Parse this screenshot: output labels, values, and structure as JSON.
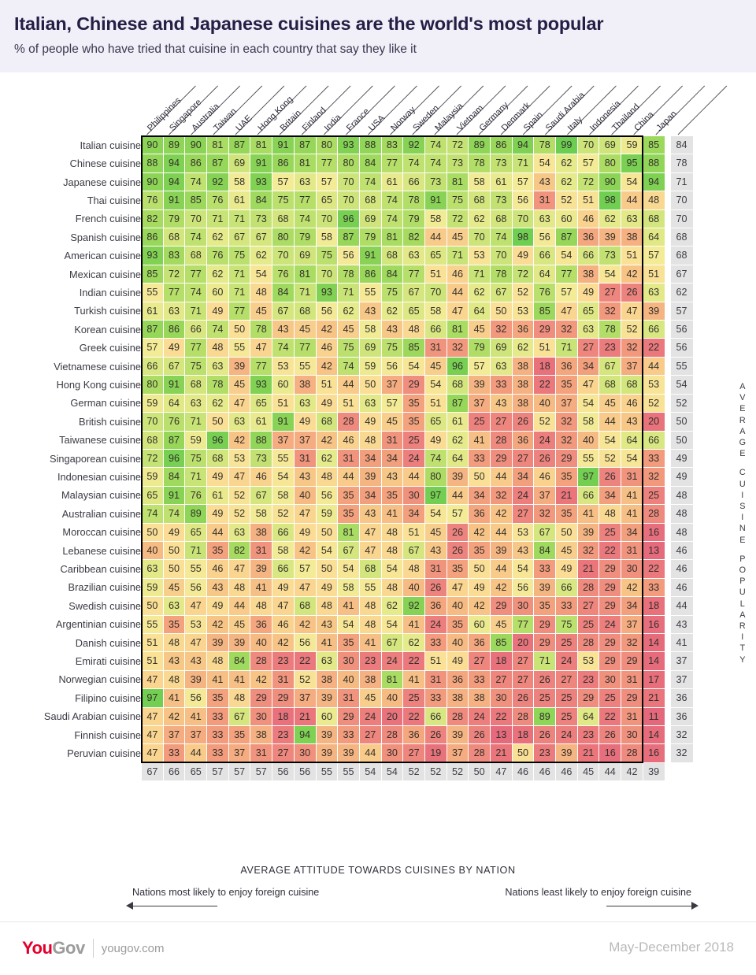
{
  "header": {
    "title": "Italian, Chinese and Japanese cuisines are the world's most popular",
    "subtitle": "% of people who have tried that cuisine in each country that say they like it"
  },
  "captions": {
    "bottom_axis": "AVERAGE ATTITUDE TOWARDS CUISINES BY NATION",
    "vertical_axis": "AVERAGE CUISINE POPULARITY",
    "arrow_left": "Nations most likely to enjoy foreign cuisine",
    "arrow_right": "Nations least likely to enjoy foreign cuisine"
  },
  "footer": {
    "logo_you": "You",
    "logo_gov": "Gov",
    "url": "yougov.com",
    "date": "May-December 2018"
  },
  "chart_data": {
    "type": "heatmap",
    "title": "Italian, Chinese and Japanese cuisines are the world's most popular",
    "subtitle": "% of people who have tried that cuisine in each country that say they like it",
    "xlabel": "AVERAGE ATTITUDE TOWARDS CUISINES BY NATION",
    "ylabel": "AVERAGE CUISINE POPULARITY",
    "value_range": [
      11,
      99
    ],
    "columns": [
      "Philippines",
      "Singapore",
      "Australia",
      "Taiwan",
      "UAE",
      "Hong Kong",
      "Britain",
      "Finland",
      "India",
      "France",
      "USA",
      "Norway",
      "Sweden",
      "Malaysia",
      "Vietnam",
      "Germany",
      "Denmark",
      "Spain",
      "Saudi Arabia",
      "Italy",
      "Indonesia",
      "Thailand",
      "China"
    ],
    "avg_column_label": "Japan",
    "rows": [
      "Italian cuisine",
      "Chinese cuisine",
      "Japanese cuisine",
      "Thai cuisine",
      "French cuisine",
      "Spanish cuisine",
      "American cuisine",
      "Mexican cuisine",
      "Indian cuisine",
      "Turkish cuisine",
      "Korean cuisine",
      "Greek cuisine",
      "Vietnamese cuisine",
      "Hong Kong cuisine",
      "German cuisine",
      "British cuisine",
      "Taiwanese cuisine",
      "Singaporean cuisine",
      "Indonesian cuisine",
      "Malaysian cuisine",
      "Australian cuisine",
      "Moroccan cuisine",
      "Lebanese cuisine",
      "Caribbean cuisine",
      "Brazilian cuisine",
      "Swedish cuisine",
      "Argentinian cuisine",
      "Danish cuisine",
      "Emirati cuisine",
      "Norwegian cuisine",
      "Filipino cuisine",
      "Saudi Arabian cuisine",
      "Finnish cuisine",
      "Peruvian cuisine"
    ],
    "values": [
      [
        90,
        89,
        90,
        81,
        87,
        81,
        91,
        87,
        80,
        93,
        88,
        83,
        92,
        74,
        72,
        89,
        86,
        94,
        78,
        99,
        70,
        69,
        59,
        85
      ],
      [
        88,
        94,
        86,
        87,
        69,
        91,
        86,
        81,
        77,
        80,
        84,
        77,
        74,
        74,
        73,
        78,
        73,
        71,
        54,
        62,
        57,
        80,
        95,
        88
      ],
      [
        90,
        94,
        74,
        92,
        58,
        93,
        57,
        63,
        57,
        70,
        74,
        61,
        66,
        73,
        81,
        58,
        61,
        57,
        43,
        62,
        72,
        90,
        54,
        94
      ],
      [
        76,
        91,
        85,
        76,
        61,
        84,
        75,
        77,
        65,
        70,
        68,
        74,
        78,
        91,
        75,
        68,
        73,
        56,
        31,
        52,
        51,
        98,
        44,
        48
      ],
      [
        82,
        79,
        70,
        71,
        71,
        73,
        68,
        74,
        70,
        96,
        69,
        74,
        79,
        58,
        72,
        62,
        68,
        70,
        63,
        60,
        46,
        62,
        63,
        68
      ],
      [
        86,
        68,
        74,
        62,
        67,
        67,
        80,
        79,
        58,
        87,
        79,
        81,
        82,
        44,
        45,
        70,
        74,
        98,
        56,
        87,
        36,
        39,
        38,
        64
      ],
      [
        93,
        83,
        68,
        76,
        75,
        62,
        70,
        69,
        75,
        56,
        91,
        68,
        63,
        65,
        71,
        53,
        70,
        49,
        66,
        54,
        66,
        73,
        51,
        57
      ],
      [
        85,
        72,
        77,
        62,
        71,
        54,
        76,
        81,
        70,
        78,
        86,
        84,
        77,
        51,
        46,
        71,
        78,
        72,
        64,
        77,
        38,
        54,
        42,
        51
      ],
      [
        55,
        77,
        74,
        60,
        71,
        48,
        84,
        71,
        93,
        71,
        55,
        75,
        67,
        70,
        44,
        62,
        67,
        52,
        76,
        57,
        49,
        27,
        26,
        63
      ],
      [
        61,
        63,
        71,
        49,
        77,
        45,
        67,
        68,
        56,
        62,
        43,
        62,
        65,
        58,
        47,
        64,
        50,
        53,
        85,
        47,
        65,
        32,
        47,
        39
      ],
      [
        87,
        86,
        66,
        74,
        50,
        78,
        43,
        45,
        42,
        45,
        58,
        43,
        48,
        66,
        81,
        45,
        32,
        36,
        29,
        32,
        63,
        78,
        52,
        66
      ],
      [
        57,
        49,
        77,
        48,
        55,
        47,
        74,
        77,
        46,
        75,
        69,
        75,
        85,
        31,
        32,
        79,
        69,
        62,
        51,
        71,
        27,
        23,
        32,
        22
      ],
      [
        66,
        67,
        75,
        63,
        39,
        77,
        53,
        55,
        42,
        74,
        59,
        56,
        54,
        45,
        96,
        57,
        63,
        38,
        18,
        36,
        34,
        67,
        37,
        44
      ],
      [
        80,
        91,
        68,
        78,
        45,
        93,
        60,
        38,
        51,
        44,
        50,
        37,
        29,
        54,
        68,
        39,
        33,
        38,
        22,
        35,
        47,
        68,
        68,
        53
      ],
      [
        59,
        64,
        63,
        62,
        47,
        65,
        51,
        63,
        49,
        51,
        63,
        57,
        35,
        51,
        87,
        37,
        43,
        38,
        40,
        37,
        54,
        45,
        46,
        52
      ],
      [
        70,
        76,
        71,
        50,
        63,
        61,
        91,
        49,
        68,
        28,
        49,
        45,
        35,
        65,
        61,
        25,
        27,
        26,
        52,
        32,
        58,
        44,
        43,
        20
      ],
      [
        68,
        87,
        59,
        96,
        42,
        88,
        37,
        37,
        42,
        46,
        48,
        31,
        25,
        49,
        62,
        41,
        28,
        36,
        24,
        32,
        40,
        54,
        64,
        66
      ],
      [
        72,
        96,
        75,
        68,
        53,
        73,
        55,
        31,
        62,
        31,
        34,
        34,
        24,
        74,
        64,
        33,
        29,
        27,
        26,
        29,
        55,
        52,
        54,
        33
      ],
      [
        59,
        84,
        71,
        49,
        47,
        46,
        54,
        43,
        48,
        44,
        39,
        43,
        44,
        80,
        39,
        50,
        44,
        34,
        46,
        35,
        97,
        26,
        31,
        32
      ],
      [
        65,
        91,
        76,
        61,
        52,
        67,
        58,
        40,
        56,
        35,
        34,
        35,
        30,
        97,
        44,
        34,
        32,
        24,
        37,
        21,
        66,
        34,
        41,
        25
      ],
      [
        74,
        74,
        89,
        49,
        52,
        58,
        52,
        47,
        59,
        35,
        43,
        41,
        34,
        54,
        57,
        36,
        42,
        27,
        32,
        35,
        41,
        48,
        41,
        28
      ],
      [
        50,
        49,
        65,
        44,
        63,
        38,
        66,
        49,
        50,
        81,
        47,
        48,
        51,
        45,
        26,
        42,
        44,
        53,
        67,
        50,
        39,
        25,
        34,
        16
      ],
      [
        40,
        50,
        71,
        35,
        82,
        31,
        58,
        42,
        54,
        67,
        47,
        48,
        67,
        43,
        26,
        35,
        39,
        43,
        84,
        45,
        32,
        22,
        31,
        13
      ],
      [
        63,
        50,
        55,
        46,
        47,
        39,
        66,
        57,
        50,
        54,
        68,
        54,
        48,
        31,
        35,
        50,
        44,
        54,
        33,
        49,
        21,
        29,
        30,
        22
      ],
      [
        59,
        45,
        56,
        43,
        48,
        41,
        49,
        47,
        49,
        58,
        55,
        48,
        40,
        26,
        47,
        49,
        42,
        56,
        39,
        66,
        28,
        29,
        42,
        33
      ],
      [
        50,
        63,
        47,
        49,
        44,
        48,
        47,
        68,
        48,
        41,
        48,
        62,
        92,
        36,
        40,
        42,
        29,
        30,
        35,
        33,
        27,
        29,
        34,
        18
      ],
      [
        55,
        35,
        53,
        42,
        45,
        36,
        46,
        42,
        43,
        54,
        48,
        54,
        41,
        24,
        35,
        60,
        45,
        77,
        29,
        75,
        25,
        24,
        37,
        16
      ],
      [
        51,
        48,
        47,
        39,
        39,
        40,
        42,
        56,
        41,
        35,
        41,
        67,
        62,
        33,
        40,
        36,
        85,
        20,
        29,
        25,
        28,
        29,
        32,
        14
      ],
      [
        51,
        43,
        43,
        48,
        84,
        28,
        23,
        22,
        63,
        30,
        23,
        24,
        22,
        51,
        49,
        27,
        18,
        27,
        71,
        24,
        53,
        29,
        29,
        14
      ],
      [
        47,
        48,
        39,
        41,
        41,
        42,
        31,
        52,
        38,
        40,
        38,
        81,
        41,
        31,
        36,
        33,
        27,
        27,
        26,
        27,
        23,
        30,
        31,
        17
      ],
      [
        97,
        41,
        56,
        35,
        48,
        29,
        29,
        37,
        39,
        31,
        45,
        40,
        25,
        33,
        38,
        38,
        30,
        26,
        25,
        25,
        29,
        25,
        29,
        21
      ],
      [
        47,
        42,
        41,
        33,
        67,
        30,
        18,
        21,
        60,
        29,
        24,
        20,
        22,
        66,
        28,
        24,
        22,
        28,
        89,
        25,
        64,
        22,
        31,
        11
      ],
      [
        47,
        37,
        37,
        33,
        35,
        38,
        23,
        94,
        39,
        33,
        27,
        28,
        36,
        26,
        39,
        26,
        13,
        18,
        26,
        24,
        23,
        26,
        30,
        14
      ],
      [
        47,
        33,
        44,
        33,
        37,
        31,
        27,
        30,
        39,
        39,
        44,
        30,
        27,
        19,
        37,
        28,
        21,
        50,
        23,
        39,
        21,
        16,
        28,
        16
      ]
    ],
    "row_averages": [
      84,
      78,
      71,
      70,
      70,
      68,
      68,
      67,
      62,
      57,
      56,
      56,
      55,
      54,
      52,
      50,
      50,
      49,
      49,
      48,
      48,
      48,
      46,
      46,
      46,
      44,
      43,
      41,
      37,
      37,
      36,
      36,
      32,
      32
    ],
    "column_averages": [
      67,
      66,
      65,
      57,
      57,
      57,
      56,
      56,
      55,
      55,
      54,
      54,
      52,
      52,
      52,
      50,
      47,
      46,
      46,
      46,
      45,
      44,
      42,
      39
    ]
  }
}
